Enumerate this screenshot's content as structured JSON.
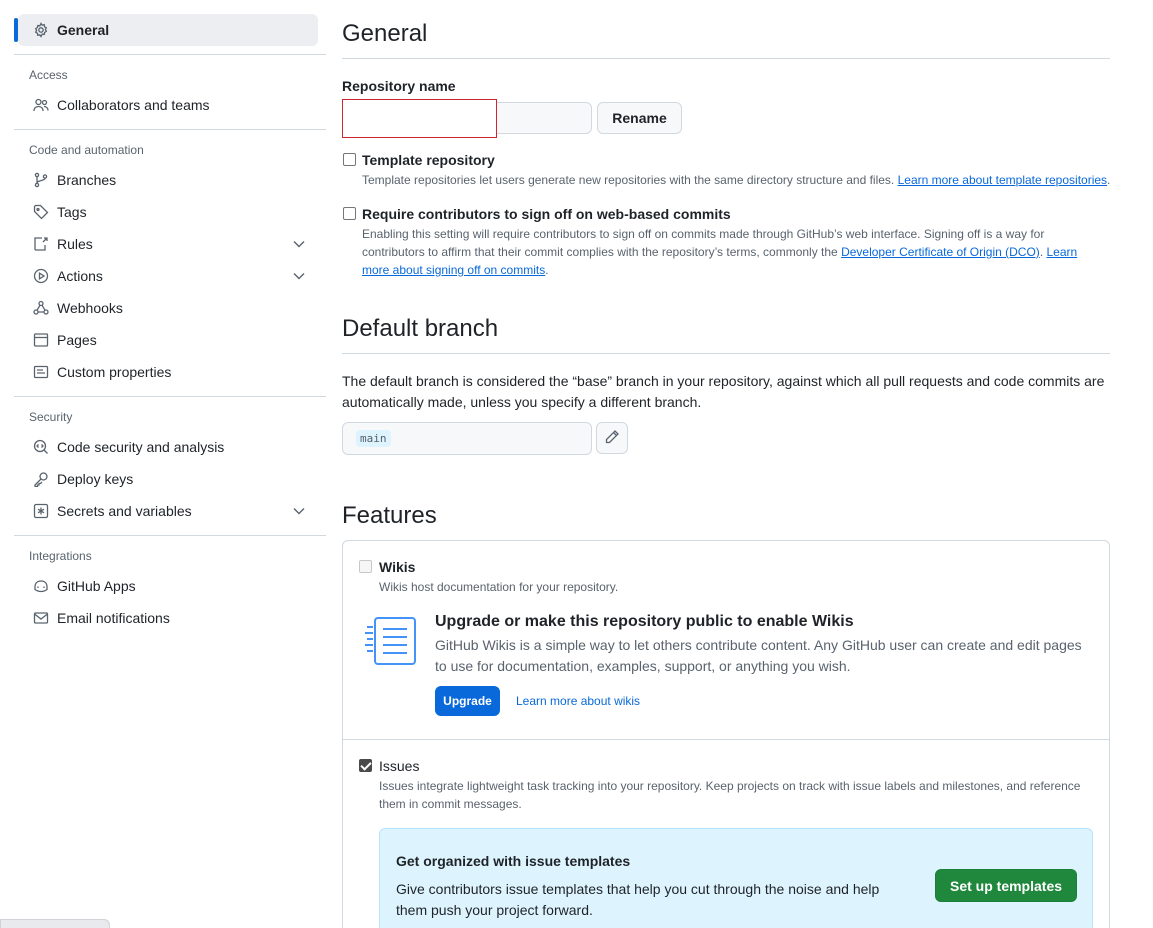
{
  "sidebar": {
    "general": "General",
    "groups": {
      "access": "Access",
      "code_automation": "Code and automation",
      "security": "Security",
      "integrations": "Integrations"
    },
    "items": {
      "collaborators": "Collaborators and teams",
      "branches": "Branches",
      "tags": "Tags",
      "rules": "Rules",
      "actions": "Actions",
      "webhooks": "Webhooks",
      "pages": "Pages",
      "custom_properties": "Custom properties",
      "code_security": "Code security and analysis",
      "deploy_keys": "Deploy keys",
      "secrets": "Secrets and variables",
      "github_apps": "GitHub Apps",
      "email_notifications": "Email notifications"
    }
  },
  "general": {
    "heading": "General",
    "repo_name_label": "Repository name",
    "repo_name_value": "",
    "rename_button": "Rename",
    "template_label": "Template repository",
    "template_note": "Template repositories let users generate new repositories with the same directory structure and files.",
    "template_link": "Learn more about template repositories",
    "signoff_label": "Require contributors to sign off on web-based commits",
    "signoff_note_1": "Enabling this setting will require contributors to sign off on commits made through GitHub’s web interface. Signing off is a way for contributors to affirm that their commit complies with the repository’s terms, commonly the",
    "signoff_link_dco": "Developer Certificate of Origin (DCO)",
    "signoff_link_learn": "Learn more about signing off on commits",
    "signoff_note_end": "."
  },
  "default_branch": {
    "heading": "Default branch",
    "description": "The default branch is considered the “base” branch in your repository, against which all pull requests and code commits are automatically made, unless you specify a different branch.",
    "branch": "main"
  },
  "features": {
    "heading": "Features",
    "wikis_label": "Wikis",
    "wikis_note": "Wikis host documentation for your repository.",
    "upgrade_title": "Upgrade or make this repository public to enable Wikis",
    "upgrade_desc": "GitHub Wikis is a simple way to let others contribute content. Any GitHub user can create and edit pages to use for documentation, examples, support, or anything you wish.",
    "upgrade_button": "Upgrade",
    "wikis_learn": "Learn more about wikis",
    "issues_label": "Issues",
    "issues_checked": true,
    "issues_note": "Issues integrate lightweight task tracking into your repository. Keep projects on track with issue labels and milestones, and reference them in commit messages.",
    "templates_title": "Get organized with issue templates",
    "templates_desc": "Give contributors issue templates that help you cut through the noise and help them push your project forward.",
    "templates_button": "Set up templates"
  },
  "colors": {
    "accent": "#0969da",
    "primary_button": "#1f883d",
    "focus_border": "#d1242f",
    "banner_bg": "#ddf4ff"
  }
}
